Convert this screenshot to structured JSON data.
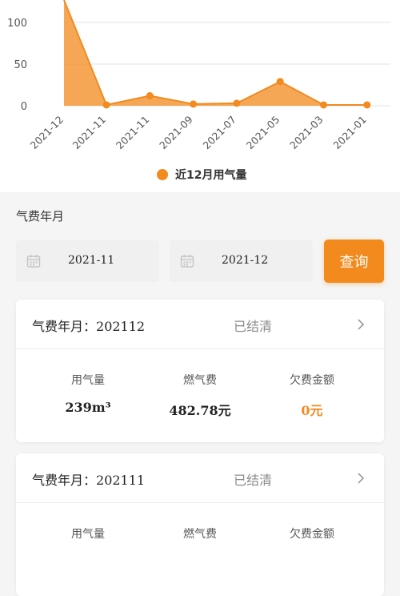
{
  "chart_data": {
    "type": "area",
    "categories": [
      "2021-12",
      "2021-11",
      "2021-11",
      "2021-09",
      "2021-07",
      "2021-05",
      "2021-03",
      "2021-01"
    ],
    "values": [
      239,
      1,
      12,
      2,
      3,
      29,
      1,
      1
    ],
    "y_ticks": [
      "0",
      "50",
      "100"
    ],
    "ylim": [
      0,
      130
    ],
    "grid": true,
    "color": "#f28a1e",
    "legend": "近12月用气量",
    "legend_position": "bottom-center"
  },
  "filter": {
    "title": "气费年月",
    "start_date": "2021-11",
    "end_date": "2021-12",
    "query_label": "查询"
  },
  "cards": [
    {
      "title_label": "气费年月：",
      "period": "202112",
      "status": "已结清",
      "usage_label": "用气量",
      "usage_value": "239m³",
      "fee_label": "燃气费",
      "fee_value": "482.78元",
      "owed_label": "欠费金额",
      "owed_value": "0元"
    },
    {
      "title_label": "气费年月：",
      "period": "202111",
      "status": "已结清",
      "usage_label": "用气量",
      "fee_label": "燃气费",
      "owed_label": "欠费金额"
    }
  ],
  "icons": {
    "calendar": "calendar-icon",
    "chevron": "chevron-right-icon"
  }
}
